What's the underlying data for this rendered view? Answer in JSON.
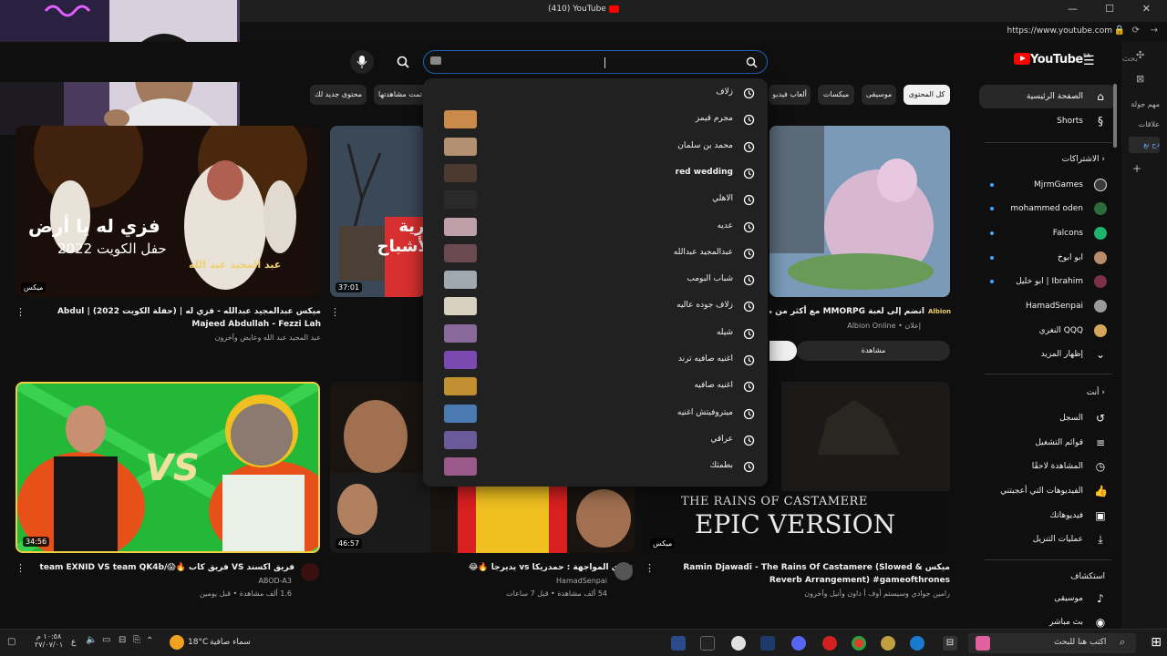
{
  "window": {
    "title": "(410) YouTube",
    "url": "https://www.youtube.com"
  },
  "right_strip": [
    "مهم جولة",
    "علاقات",
    "دح نع",
    "+"
  ],
  "header": {
    "logo_text": "YouTube",
    "logo_region": "SA",
    "search_placeholder": "بحث",
    "icons": [
      "search-icon",
      "mic-icon",
      "menu-icon"
    ]
  },
  "chips": [
    "كل المحتوى",
    "موسيقى",
    "ميكسات",
    "ألعاب فيديو",
    "تمت مشاهدتها",
    "محتوى جديد لك"
  ],
  "sidebar": {
    "primary": [
      {
        "label": "الصفحة الرئيسية",
        "icon": "home-icon"
      },
      {
        "label": "Shorts",
        "icon": "shorts-icon"
      }
    ],
    "subscriptions_title": "الاشتراكات",
    "subscriptions": [
      {
        "label": "MjrmGames",
        "color": "#3a3a3a"
      },
      {
        "label": "mohammed oden",
        "color": "#2e6b3a"
      },
      {
        "label": "Falcons",
        "color": "#1db56b"
      },
      {
        "label": "ابو ابوخ",
        "color": "#b98b6a"
      },
      {
        "label": "ابو خليل | Ibrahim",
        "color": "#7d3048"
      },
      {
        "label": "HamadSenpai",
        "color": "#9a9a9a"
      },
      {
        "label": "النغري QQQ",
        "color": "#d4a55a"
      },
      {
        "label": "إظهار المزيد",
        "icon": "chevron-down-icon"
      }
    ],
    "you_title": "أنت",
    "you": [
      {
        "label": "السجل",
        "icon": "history-icon"
      },
      {
        "label": "قوائم التشغيل",
        "icon": "playlist-icon"
      },
      {
        "label": "المشاهدة لاحقًا",
        "icon": "clock-icon"
      },
      {
        "label": "الفيديوهات التي أعجبتني",
        "icon": "thumb-up-icon"
      },
      {
        "label": "فيديوهاتك",
        "icon": "video-icon"
      },
      {
        "label": "عمليات التنزيل",
        "icon": "download-icon"
      }
    ],
    "explore_title": "استكشاف",
    "explore": [
      {
        "label": "موسيقى",
        "icon": "music-icon"
      },
      {
        "label": "بث مباشر",
        "icon": "live-icon"
      }
    ]
  },
  "videos": [
    {
      "title": "ميكس عبدالمجيد عبدالله - فزي له | (حفلة الكويت 2022) | Abdul Majeed Abdullah - Fezzi Lah",
      "meta": "عبد المجيد عبد الله وعايض وآخرون",
      "duration": "ميكس",
      "thumb_text": "فزي له يا أرض",
      "thumb_sub": "حفل الكويت 2022",
      "thumb_name": "عبد المجيد عبد الله"
    },
    {
      "title": "",
      "meta": "",
      "duration": "37:01",
      "thumb_text": "قرية الأشباح"
    },
    {
      "title": "انضم إلى لعبة MMORPG مع أكثر من مليون لا",
      "meta": "إعلان • Albion Online",
      "duration": "",
      "button": "مشاهدة"
    },
    {
      "title": "فريق اكسند VS فريق كاب 🔥😱/team EXNID VS team QK4b",
      "channel": "ABOD-A3",
      "meta": "1.6 ألف مشاهدة • قبل يومين",
      "duration": "34:56"
    },
    {
      "title": "تحدي المواجهة : حمدريكا vs يديرجا 🔥😂",
      "channel": "HamadSenpai",
      "meta": "54 ألف مشاهدة • قبل 7 ساعات",
      "duration": "46:57"
    },
    {
      "title": "ميكس Ramin Djawadi - The Rains Of Castamere (Slowed & Reverb Arrangement) #gameofthrones",
      "meta": "رامين جوادي وسيستم أوف أ داون وأنيل وآخرون",
      "duration": "ميكس",
      "thumb_text": "THE RAINS OF CASTAMERE",
      "thumb_sub": "EPIC VERSION"
    }
  ],
  "suggestions": [
    {
      "text": "زلاف",
      "thumb": null
    },
    {
      "text": "مجرم قيمز",
      "thumb": "#c98a4a"
    },
    {
      "text": "محمد بن سلمان",
      "thumb": "#b09070"
    },
    {
      "text": "red wedding",
      "thumb": "#4a3a30",
      "bold": true
    },
    {
      "text": "الاهلي",
      "thumb": "#2a2a2a"
    },
    {
      "text": "عديه",
      "thumb": "#c0a0a8"
    },
    {
      "text": "عبدالمجيد عبدالله",
      "thumb": "#6a4a50"
    },
    {
      "text": "شباب البومب",
      "thumb": "#a0a8b0"
    },
    {
      "text": "زلاف جوده عاليه",
      "thumb": "#d8d0c0"
    },
    {
      "text": "شيله",
      "thumb": "#8a6a9a"
    },
    {
      "text": "اغنيه صافيه ترند",
      "thumb": "#7a4ab0"
    },
    {
      "text": "اغنيه صافيه",
      "thumb": "#c09030"
    },
    {
      "text": "ميتروفيتش اغنيه",
      "thumb": "#4a7ab0"
    },
    {
      "text": "عراقي",
      "thumb": "#6a5a9a"
    },
    {
      "text": "بطمثك",
      "thumb": "#9a5a8a"
    }
  ],
  "taskbar": {
    "search_placeholder": "اكتب هنا للبحث",
    "weather": "سماء صافية",
    "temp": "18°C",
    "time": "١٠:٥٨ م",
    "date": "٢٧/٠٧/٠١",
    "lang": "ع"
  }
}
